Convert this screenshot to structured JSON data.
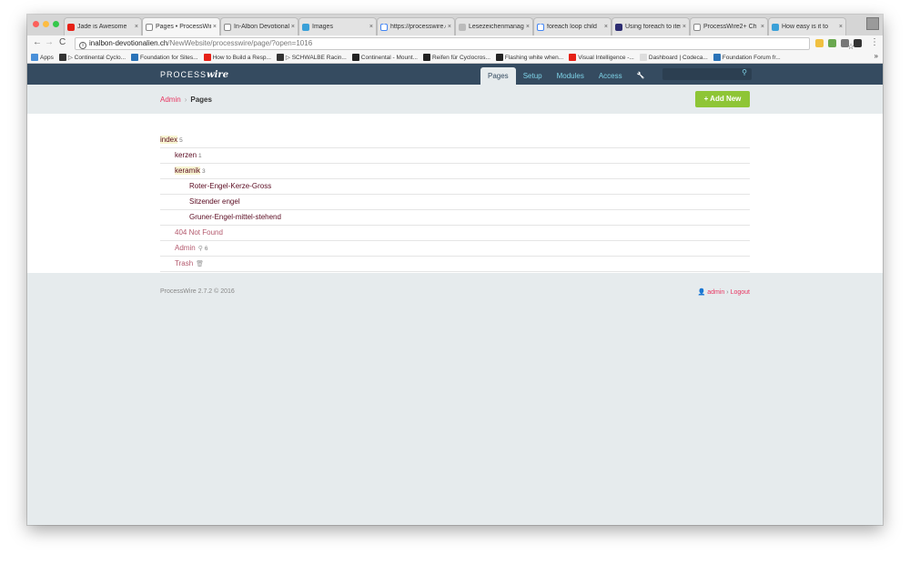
{
  "browser": {
    "tabs": [
      {
        "title": "Jade is Awesome",
        "favicon": "youtube-icon",
        "active": false
      },
      {
        "title": "Pages • ProcessWire",
        "favicon": "document-icon",
        "active": true
      },
      {
        "title": "In-Albon Devotionalien",
        "favicon": "document-icon",
        "active": false
      },
      {
        "title": "Images",
        "favicon": "image-icon",
        "active": false
      },
      {
        "title": "https://processwire.com",
        "favicon": "google-icon",
        "active": false
      },
      {
        "title": "Lesezeichenmanager",
        "favicon": "blank-icon",
        "active": false
      },
      {
        "title": "foreach loop child",
        "favicon": "google-icon",
        "active": false
      },
      {
        "title": "Using foreach to iterate",
        "favicon": "processwire-icon",
        "active": false
      },
      {
        "title": "ProcessWire2+ Ch",
        "favicon": "document-icon",
        "active": false
      },
      {
        "title": "How easy is it to",
        "favicon": "image-icon",
        "active": false
      }
    ],
    "url_host": "inalbon-devotionalien.ch",
    "url_path": "/NewWebsite/processwire/page/?open=1016",
    "bookmarks": [
      {
        "label": "Apps",
        "color": "#4a90d9"
      },
      {
        "label": "▷ Continental Cyclo...",
        "color": "#333333"
      },
      {
        "label": "Foundation for Sites...",
        "color": "#2a73b8"
      },
      {
        "label": "How to Build a Resp...",
        "color": "#e62117"
      },
      {
        "label": "▷ SCHWALBE Racin...",
        "color": "#333333"
      },
      {
        "label": "Continental - Mount...",
        "color": "#222222"
      },
      {
        "label": "Reifen für Cyclocros...",
        "color": "#222222"
      },
      {
        "label": "Flashing white when...",
        "color": "#222222"
      },
      {
        "label": "Visual Intelligence -...",
        "color": "#e62117"
      },
      {
        "label": "Dashboard | Codeca...",
        "color": "#dddddd"
      },
      {
        "label": "Foundation Forum fr...",
        "color": "#2a73b8"
      }
    ]
  },
  "header": {
    "logo_prefix": "PROCESS",
    "logo_suffix": "wire",
    "nav": [
      {
        "label": "Pages",
        "active": true
      },
      {
        "label": "Setup",
        "active": false
      },
      {
        "label": "Modules",
        "active": false
      },
      {
        "label": "Access",
        "active": false
      }
    ],
    "wrench_glyph": "🔧"
  },
  "breadcrumb": {
    "root": "Admin",
    "current": "Pages"
  },
  "add_new_label": "+ Add New",
  "tree": [
    {
      "label": "index",
      "count": "5",
      "depth": 0,
      "highlight": true,
      "system": false
    },
    {
      "label": "kerzen",
      "count": "1",
      "depth": 1,
      "highlight": false,
      "system": false
    },
    {
      "label": "keramik",
      "count": "3",
      "depth": 1,
      "highlight": true,
      "system": false
    },
    {
      "label": "Roter-Engel-Kerze-Gross",
      "count": "",
      "depth": 2,
      "highlight": false,
      "system": false
    },
    {
      "label": "Sitzender engel",
      "count": "",
      "depth": 2,
      "highlight": false,
      "system": false
    },
    {
      "label": "Gruner-Engel-mittel-stehend",
      "count": "",
      "depth": 2,
      "highlight": false,
      "system": false
    },
    {
      "label": "404 Not Found",
      "count": "",
      "depth": 1,
      "highlight": false,
      "system": true
    },
    {
      "label": "Admin",
      "count": "6",
      "depth": 1,
      "highlight": false,
      "system": true,
      "icon": "key-icon"
    },
    {
      "label": "Trash",
      "count": "",
      "depth": 1,
      "highlight": false,
      "system": true,
      "icon": "trash-icon"
    }
  ],
  "footer": {
    "copyright": "ProcessWire 2.7.2 © 2016",
    "user": "admin",
    "logout": "Logout"
  }
}
